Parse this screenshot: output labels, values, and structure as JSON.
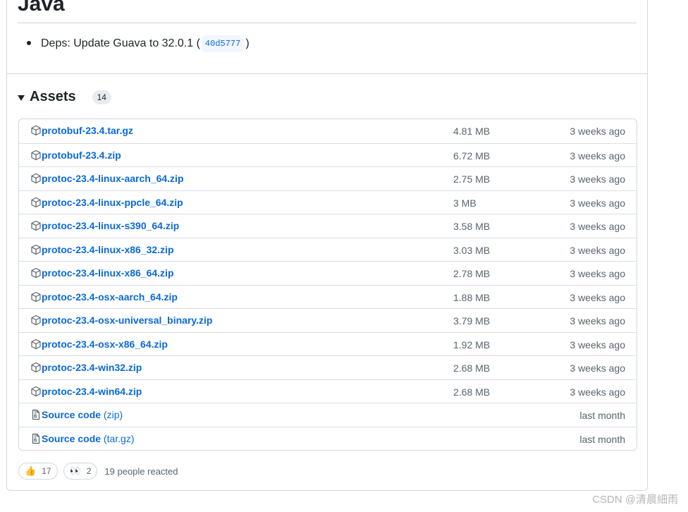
{
  "release": {
    "heading": "Java",
    "notes": [
      {
        "text": "Deps: Update Guava to 32.0.1 (",
        "sha": "40d5777",
        "close": ")"
      }
    ]
  },
  "assets": {
    "title": "Assets",
    "count": "14",
    "items": [
      {
        "name": "protobuf-23.4.tar.gz",
        "suffix": "",
        "size": "4.81 MB",
        "time": "3 weeks ago",
        "icon": "package-icon"
      },
      {
        "name": "protobuf-23.4.zip",
        "suffix": "",
        "size": "6.72 MB",
        "time": "3 weeks ago",
        "icon": "package-icon"
      },
      {
        "name": "protoc-23.4-linux-aarch_64.zip",
        "suffix": "",
        "size": "2.75 MB",
        "time": "3 weeks ago",
        "icon": "package-icon"
      },
      {
        "name": "protoc-23.4-linux-ppcle_64.zip",
        "suffix": "",
        "size": "3 MB",
        "time": "3 weeks ago",
        "icon": "package-icon"
      },
      {
        "name": "protoc-23.4-linux-s390_64.zip",
        "suffix": "",
        "size": "3.58 MB",
        "time": "3 weeks ago",
        "icon": "package-icon"
      },
      {
        "name": "protoc-23.4-linux-x86_32.zip",
        "suffix": "",
        "size": "3.03 MB",
        "time": "3 weeks ago",
        "icon": "package-icon"
      },
      {
        "name": "protoc-23.4-linux-x86_64.zip",
        "suffix": "",
        "size": "2.78 MB",
        "time": "3 weeks ago",
        "icon": "package-icon"
      },
      {
        "name": "protoc-23.4-osx-aarch_64.zip",
        "suffix": "",
        "size": "1.88 MB",
        "time": "3 weeks ago",
        "icon": "package-icon"
      },
      {
        "name": "protoc-23.4-osx-universal_binary.zip",
        "suffix": "",
        "size": "3.79 MB",
        "time": "3 weeks ago",
        "icon": "package-icon"
      },
      {
        "name": "protoc-23.4-osx-x86_64.zip",
        "suffix": "",
        "size": "1.92 MB",
        "time": "3 weeks ago",
        "icon": "package-icon"
      },
      {
        "name": "protoc-23.4-win32.zip",
        "suffix": "",
        "size": "2.68 MB",
        "time": "3 weeks ago",
        "icon": "package-icon"
      },
      {
        "name": "protoc-23.4-win64.zip",
        "suffix": "",
        "size": "2.68 MB",
        "time": "3 weeks ago",
        "icon": "package-icon"
      },
      {
        "name": "Source code",
        "suffix": " (zip)",
        "size": "",
        "time": "last month",
        "icon": "file-zip-icon"
      },
      {
        "name": "Source code",
        "suffix": " (tar.gz)",
        "size": "",
        "time": "last month",
        "icon": "file-zip-icon"
      }
    ]
  },
  "reactions": {
    "items": [
      {
        "emoji": "👍",
        "count": "17",
        "icon": "thumbs-up-icon"
      },
      {
        "emoji": "👀",
        "count": "2",
        "icon": "eyes-icon"
      }
    ],
    "summary": "19 people reacted"
  },
  "watermark": "CSDN @清晨細雨",
  "colors": {
    "link": "#0969da",
    "border": "#d0d7de",
    "muted": "#59636e"
  }
}
